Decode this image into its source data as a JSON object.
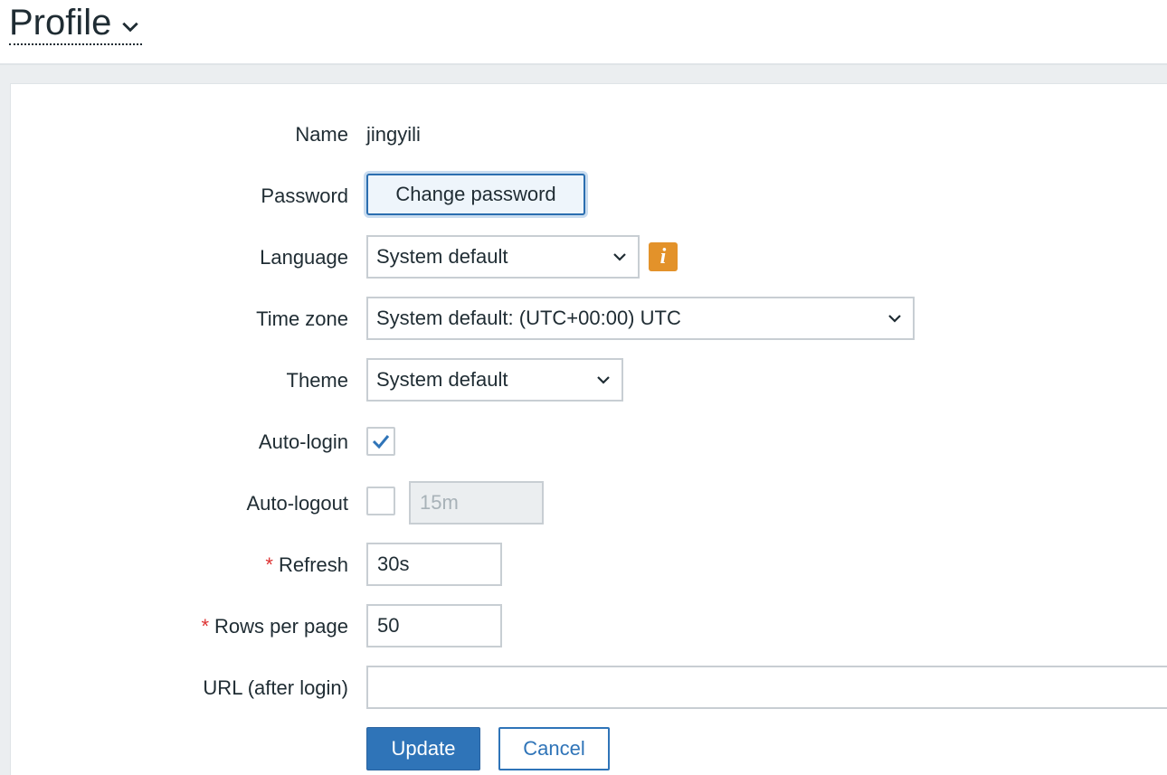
{
  "page": {
    "title": "Profile"
  },
  "form": {
    "name": {
      "label": "Name",
      "value": "jingyili"
    },
    "password": {
      "label": "Password",
      "button_label": "Change password"
    },
    "language": {
      "label": "Language",
      "selected": "System default",
      "info_icon": "i"
    },
    "timezone": {
      "label": "Time zone",
      "selected": "System default: (UTC+00:00) UTC"
    },
    "theme": {
      "label": "Theme",
      "selected": "System default"
    },
    "autologin": {
      "label": "Auto-login",
      "checked": true
    },
    "autologout": {
      "label": "Auto-logout",
      "checked": false,
      "value": "15m"
    },
    "refresh": {
      "label": "Refresh",
      "required_mark": "*",
      "value": "30s"
    },
    "rows_per_page": {
      "label": "Rows per page",
      "required_mark": "*",
      "value": "50"
    },
    "url_after_login": {
      "label": "URL (after login)",
      "value": ""
    }
  },
  "actions": {
    "update_label": "Update",
    "cancel_label": "Cancel"
  },
  "colors": {
    "primary": "#2f74b8",
    "info": "#e3922a",
    "required": "#dd3333",
    "background": "#ebeef0"
  }
}
